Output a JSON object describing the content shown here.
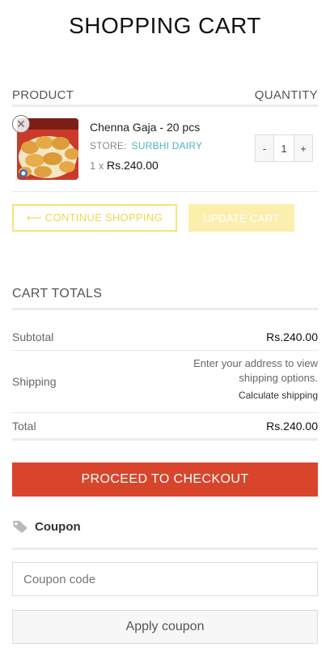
{
  "page": {
    "title": "SHOPPING CART"
  },
  "cart": {
    "header_product": "PRODUCT",
    "header_quantity": "QUANTITY",
    "item": {
      "name": "Chenna Gaja - 20 pcs",
      "store_label": "STORE:",
      "store_name": "SURBHI DAIRY",
      "qty_prefix": "1 x",
      "price": "Rs.240.00",
      "quantity": "1",
      "minus": "-",
      "plus": "+",
      "remove_icon": "close-circle-icon"
    },
    "continue_label": "⟵ CONTINUE SHOPPING",
    "update_label": "UPDATE CART"
  },
  "totals": {
    "title": "CART TOTALS",
    "subtotal_label": "Subtotal",
    "subtotal_value": "Rs.240.00",
    "shipping_label": "Shipping",
    "shipping_info": "Enter your address to view shipping options.",
    "calculate_label": "Calculate shipping",
    "total_label": "Total",
    "total_value": "Rs.240.00",
    "checkout_label": "PROCEED TO CHECKOUT"
  },
  "coupon": {
    "icon": "tag-icon",
    "heading": "Coupon",
    "placeholder": "Coupon code",
    "apply_label": "Apply coupon"
  },
  "colors": {
    "accent_yellow": "#f7e27a",
    "update_yellow": "#fcefad",
    "checkout_red": "#d8452b",
    "store_teal": "#4fb3bf"
  }
}
